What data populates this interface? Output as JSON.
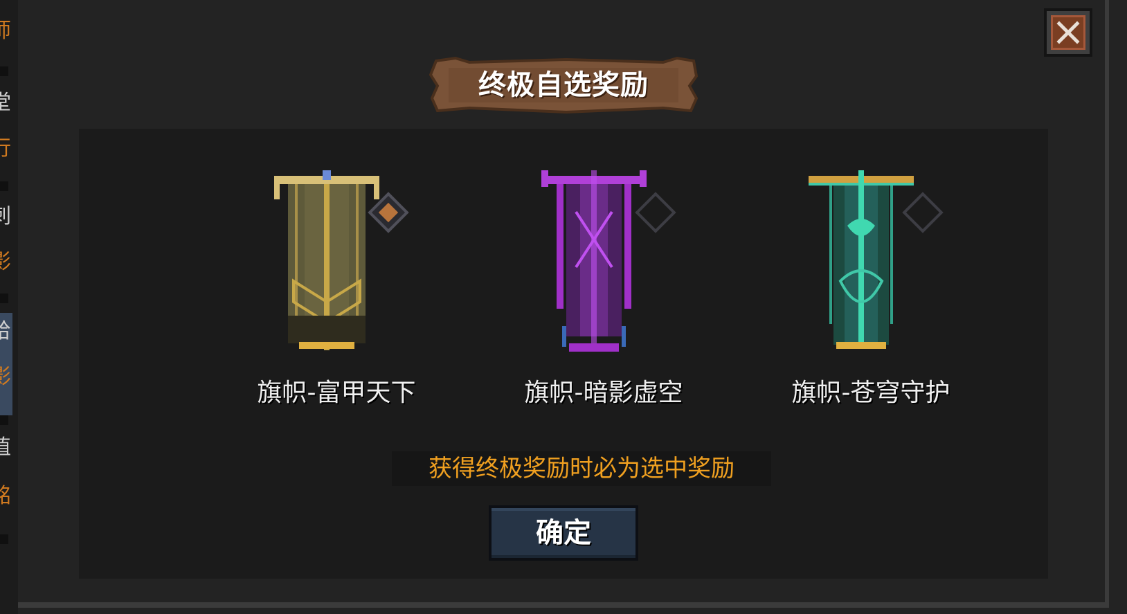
{
  "side_strip": {
    "glyphs": [
      "师",
      "堂",
      "行",
      "刺",
      "影",
      "给",
      "影",
      "值",
      "铭"
    ]
  },
  "modal": {
    "title": "终极自选奖励",
    "close_icon": "close-x-icon",
    "rewards": [
      {
        "name": "旗帜-富甲天下",
        "color": "#c8b060",
        "selected": true
      },
      {
        "name": "旗帜-暗影虚空",
        "color": "#a020c8",
        "selected": false
      },
      {
        "name": "旗帜-苍穹守护",
        "color": "#20b890",
        "selected": false
      }
    ],
    "notice": "获得终极奖励时必为选中奖励",
    "confirm_label": "确定"
  },
  "colors": {
    "notice_text": "#f0a020",
    "button_bg": "#263446",
    "plaque": "#7a5338"
  }
}
